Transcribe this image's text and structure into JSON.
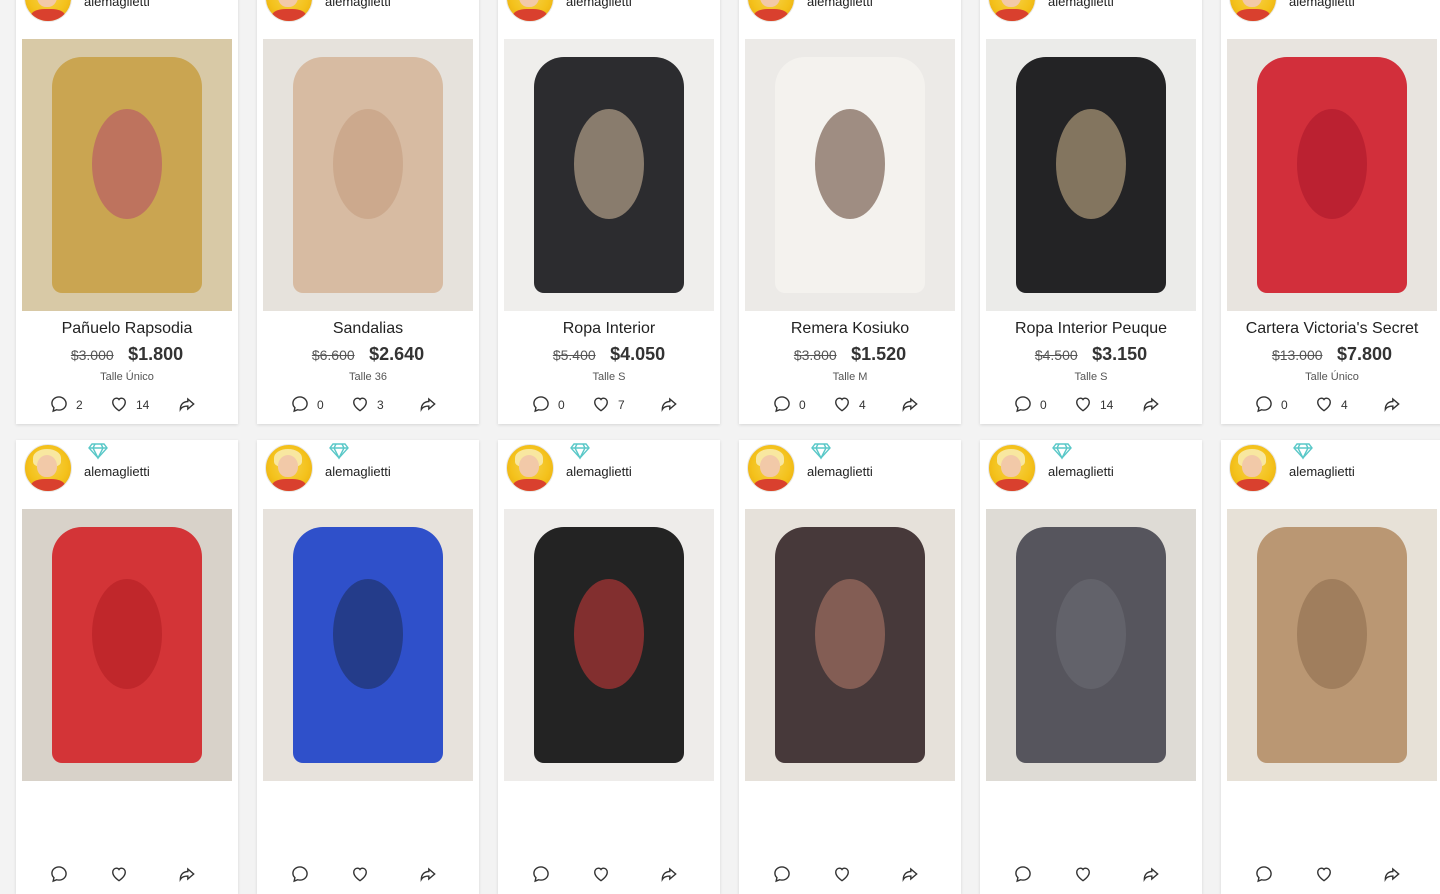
{
  "brand_colors": {
    "diamond": "#5ac8c8",
    "card_bg": "#ffffff",
    "page_bg": "#f3f3f3"
  },
  "icons": {
    "comment": "comment-icon",
    "like": "heart-icon",
    "share": "share-icon",
    "badge": "diamond-icon"
  },
  "products": [
    {
      "user": "alemaglietti",
      "title": "Pañuelo Rapsodia",
      "old_price": "$3.000",
      "price": "$1.800",
      "size": "Talle Único",
      "comments": "2",
      "likes": "14",
      "photo_colors": [
        "#d8c9a6",
        "#c9a24a",
        "#b44b6a"
      ]
    },
    {
      "user": "alemaglietti",
      "title": "Sandalias",
      "old_price": "$6.600",
      "price": "$2.640",
      "size": "Talle 36",
      "comments": "0",
      "likes": "3",
      "photo_colors": [
        "#e6e2dc",
        "#d6b79c",
        "#c29a7c"
      ]
    },
    {
      "user": "alemaglietti",
      "title": "Ropa Interior",
      "old_price": "$5.400",
      "price": "$4.050",
      "size": "Talle S",
      "comments": "0",
      "likes": "7",
      "photo_colors": [
        "#efeeec",
        "#1b1b1e",
        "#d7c0a0"
      ]
    },
    {
      "user": "alemaglietti",
      "title": "Remera Kosiuko",
      "old_price": "$3.800",
      "price": "$1.520",
      "size": "Talle M",
      "comments": "0",
      "likes": "4",
      "photo_colors": [
        "#eceae7",
        "#f4f2ef",
        "#5a3a2a"
      ]
    },
    {
      "user": "alemaglietti",
      "title": "Ropa Interior Peuque",
      "old_price": "$4.500",
      "price": "$3.150",
      "size": "Talle S",
      "comments": "0",
      "likes": "14",
      "photo_colors": [
        "#ebebe9",
        "#111114",
        "#d4b98f"
      ]
    },
    {
      "user": "alemaglietti",
      "title": "Cartera Victoria's Secret",
      "old_price": "$13.000",
      "price": "$7.800",
      "size": "Talle Único",
      "comments": "0",
      "likes": "4",
      "photo_colors": [
        "#e8e4df",
        "#cf1f2c",
        "#a8152a"
      ]
    },
    {
      "user": "alemaglietti",
      "title": "",
      "old_price": "",
      "price": "",
      "size": "",
      "comments": "",
      "likes": "",
      "photo_colors": [
        "#d8d2c9",
        "#d2262a",
        "#b01d23"
      ]
    },
    {
      "user": "alemaglietti",
      "title": "",
      "old_price": "",
      "price": "",
      "size": "",
      "comments": "",
      "likes": "",
      "photo_colors": [
        "#e7e2dc",
        "#1f43c8",
        "#1b2b55"
      ]
    },
    {
      "user": "alemaglietti",
      "title": "",
      "old_price": "",
      "price": "",
      "size": "",
      "comments": "",
      "likes": "",
      "photo_colors": [
        "#eeecea",
        "#111111",
        "#d13a3a"
      ]
    },
    {
      "user": "alemaglietti",
      "title": "",
      "old_price": "",
      "price": "",
      "size": "",
      "comments": "",
      "likes": "",
      "photo_colors": [
        "#e6e1da",
        "#3a2a2c",
        "#b57c6a"
      ]
    },
    {
      "user": "alemaglietti",
      "title": "",
      "old_price": "",
      "price": "",
      "size": "",
      "comments": "",
      "likes": "",
      "photo_colors": [
        "#dedbd5",
        "#4a4a52",
        "#6e6e74"
      ]
    },
    {
      "user": "alemaglietti",
      "title": "",
      "old_price": "",
      "price": "",
      "size": "",
      "comments": "",
      "likes": "",
      "photo_colors": [
        "#e7e1d7",
        "#b6906a",
        "#8a6a4a"
      ]
    }
  ]
}
